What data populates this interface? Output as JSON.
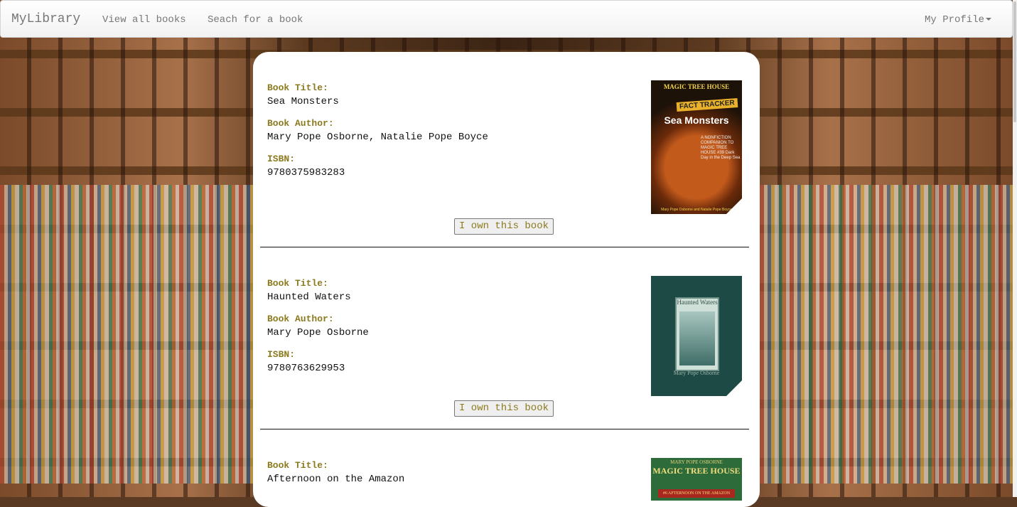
{
  "navbar": {
    "brand": "MyLibrary",
    "view_all": "View all books",
    "search": "Seach for a book",
    "profile": "My Profile"
  },
  "labels": {
    "title": "Book Title:",
    "author": "Book Author:",
    "isbn": "ISBN:",
    "own_button": "I own this book"
  },
  "books": [
    {
      "title": "Sea Monsters",
      "author": "Mary Pope Osborne, Natalie Pope Boyce",
      "isbn": "9780375983283",
      "cover": {
        "series": "MAGIC TREE HOUSE",
        "badge": "FACT TRACKER",
        "title": "Sea Monsters",
        "subtitle": "A NONFICTION COMPANION TO MAGIC TREE HOUSE #39 Dark Day in the Deep Sea",
        "authors": "Mary Pope Osborne and Natalie Pope Boyce"
      }
    },
    {
      "title": "Haunted Waters",
      "author": "Mary Pope Osborne",
      "isbn": "9780763629953",
      "cover": {
        "title": "Haunted Waters",
        "author": "Mary Pope Osborne"
      }
    },
    {
      "title": "Afternoon on the Amazon",
      "cover": {
        "top": "MARY POPE OSBORNE",
        "series": "MAGIC TREE HOUSE",
        "banner": "#6 AFTERNOON ON THE AMAZON"
      }
    }
  ],
  "colors": {
    "label": "#8b7a1e",
    "navbar_text": "#777777"
  }
}
